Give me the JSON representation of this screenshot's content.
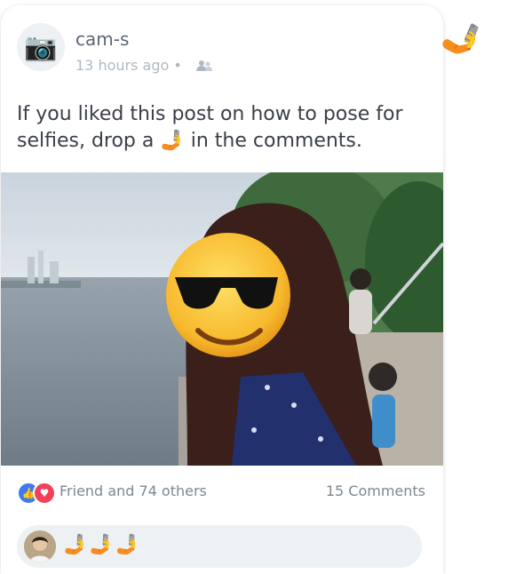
{
  "post": {
    "author": "cam-s",
    "timestamp": "13 hours ago",
    "timestamp_separator": "•",
    "audience_icon": "friends-icon",
    "avatar_icon": "📷",
    "text": "If you liked this post on how to pose for selfies, drop a 🤳 in the comments."
  },
  "reactions": {
    "like_icon": "👍",
    "love_icon": "♥",
    "summary": "Friend and 74 others",
    "comments": "15 Comments"
  },
  "comment_box": {
    "text": "🤳🤳🤳"
  },
  "side_emoji": "🤳",
  "photo_overlay_emoji": "😎"
}
